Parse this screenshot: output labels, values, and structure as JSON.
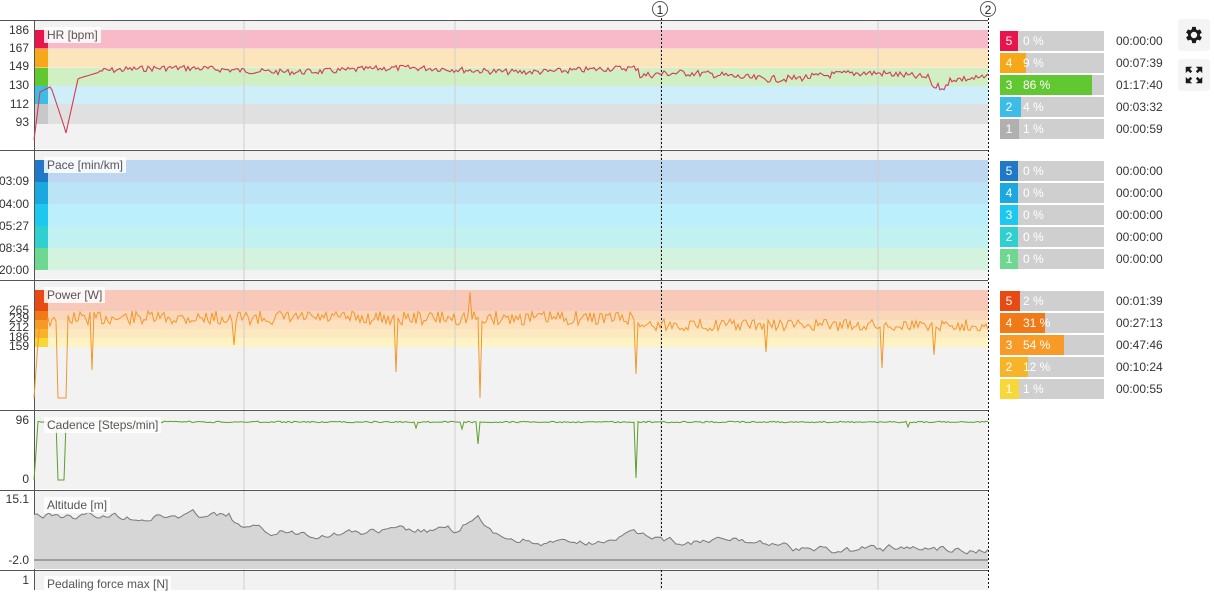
{
  "markers": [
    "1",
    "2"
  ],
  "panels": [
    {
      "id": "hr",
      "label": "HR [bpm]",
      "ticks": [
        "186",
        "167",
        "149",
        "130",
        "112",
        "93"
      ],
      "zone_colors": [
        "#e8144c",
        "#f6a818",
        "#62c832",
        "#3cbde8",
        "#b0b0b0"
      ],
      "zones": [
        {
          "num": "5",
          "pct": "0 %",
          "frac": 0.0,
          "time": "00:00:00"
        },
        {
          "num": "4",
          "pct": "9 %",
          "frac": 0.09,
          "time": "00:07:39"
        },
        {
          "num": "3",
          "pct": "86 %",
          "frac": 0.86,
          "time": "01:17:40"
        },
        {
          "num": "2",
          "pct": "4 %",
          "frac": 0.04,
          "time": "00:03:32"
        },
        {
          "num": "1",
          "pct": "1 %",
          "frac": 0.01,
          "time": "00:00:59"
        }
      ]
    },
    {
      "id": "pace",
      "label": "Pace [min/km]",
      "ticks": [
        "03:09",
        "04:00",
        "05:27",
        "08:34",
        "20:00"
      ],
      "zone_colors": [
        "#1f78c8",
        "#1ba8e0",
        "#1cc8f0",
        "#30d0d0",
        "#6ed890"
      ],
      "zones": [
        {
          "num": "5",
          "pct": "0 %",
          "frac": 0.0,
          "time": "00:00:00"
        },
        {
          "num": "4",
          "pct": "0 %",
          "frac": 0.0,
          "time": "00:00:00"
        },
        {
          "num": "3",
          "pct": "0 %",
          "frac": 0.0,
          "time": "00:00:00"
        },
        {
          "num": "2",
          "pct": "0 %",
          "frac": 0.0,
          "time": "00:00:00"
        },
        {
          "num": "1",
          "pct": "0 %",
          "frac": 0.0,
          "time": "00:00:00"
        }
      ]
    },
    {
      "id": "power",
      "label": "Power [W]",
      "ticks": [
        "265",
        "239",
        "212",
        "186",
        "159"
      ],
      "zone_colors": [
        "#e84a14",
        "#f07a18",
        "#f89a28",
        "#f8b428",
        "#f8d838"
      ],
      "zones": [
        {
          "num": "5",
          "pct": "2 %",
          "frac": 0.02,
          "time": "00:01:39"
        },
        {
          "num": "4",
          "pct": "31 %",
          "frac": 0.31,
          "time": "00:27:13"
        },
        {
          "num": "3",
          "pct": "54 %",
          "frac": 0.54,
          "time": "00:47:46"
        },
        {
          "num": "2",
          "pct": "12 %",
          "frac": 0.12,
          "time": "00:10:24"
        },
        {
          "num": "1",
          "pct": "1 %",
          "frac": 0.01,
          "time": "00:00:55"
        }
      ]
    },
    {
      "id": "cadence",
      "label": "Cadence [Steps/min]",
      "ticks": [
        "96",
        "0"
      ]
    },
    {
      "id": "altitude",
      "label": "Altitude [m]",
      "ticks": [
        "15.1",
        "-2.0"
      ]
    },
    {
      "id": "pedaling",
      "label": "Pedaling force max [N]",
      "ticks": [
        "1"
      ]
    }
  ],
  "colors": {
    "hr_line": "#d33a55",
    "power_line": "#f4962c",
    "cadence_line": "#5aa02c",
    "altitude_line": "#777777",
    "altitude_fill": "#d6d6d6",
    "plot_bg": "#f2f2f2"
  },
  "toolbar": {
    "settings_icon": "gear-icon",
    "fullscreen_icon": "expand-icon"
  }
}
